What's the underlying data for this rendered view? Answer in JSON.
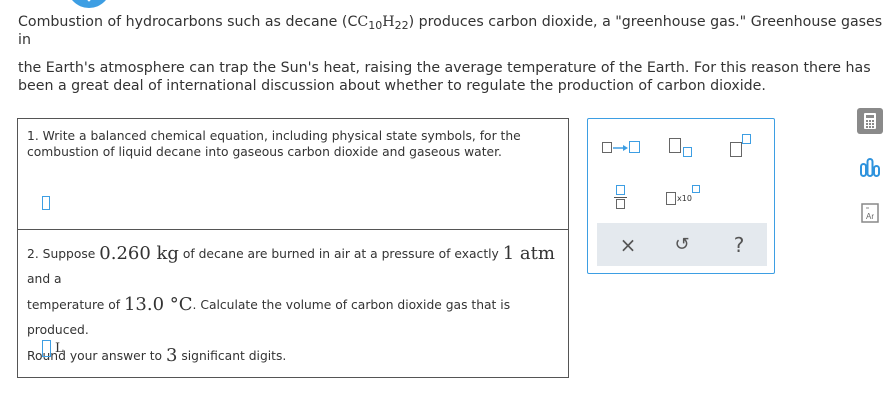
{
  "intro": {
    "p1_before": "Combustion of hydrocarbons such as decane (C",
    "p1_sub1": "10",
    "p1_mid": "H",
    "p1_sub2": "22",
    "p1_after": ") produces carbon dioxide, a \"greenhouse gas.\" Greenhouse gases in",
    "p2": "the Earth's atmosphere can trap the Sun's heat, raising the average temperature of the Earth. For this reason there has been a great deal of international discussion about whether to regulate the production of carbon dioxide."
  },
  "question1": {
    "text": "1. Write a balanced chemical equation, including physical state symbols, for the combustion of liquid decane into gaseous carbon dioxide and gaseous water.",
    "answer_value": ""
  },
  "question2": {
    "t1": "2. Suppose ",
    "mass": "0.260 kg",
    "t2": " of decane are burned in air at a pressure of exactly ",
    "pressure": "1 atm",
    "t3": " and a",
    "t4": "temperature of ",
    "temperature": "13.0 °C",
    "t5": ". Calculate the volume of carbon dioxide gas that is produced.",
    "t6": "Round your answer to ",
    "sigfigs": "3",
    "t7": " significant digits.",
    "answer_value": "",
    "unit": "L"
  },
  "palette": {
    "times_label": "x10",
    "clear_symbol": "×",
    "undo_symbol": "↺",
    "help_symbol": "?"
  },
  "colors": {
    "accent": "#3d9ee3",
    "bar": "#e4e9ee"
  }
}
